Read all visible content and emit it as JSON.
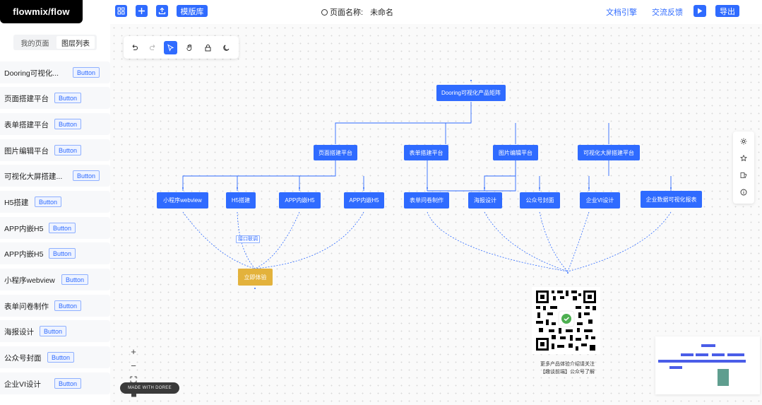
{
  "header": {
    "logo": "flowmix/flow",
    "template_label": "模版库",
    "page_name_label": "页面名称:",
    "page_name_value": "未命名",
    "doc_link": "文档引擎",
    "feedback_link": "交流反馈",
    "export_label": "导出"
  },
  "sidebar": {
    "tabs": [
      "我的页面",
      "图层列表"
    ],
    "active_tab": 1,
    "items": [
      {
        "label": "Dooring可视化...",
        "button": "Button"
      },
      {
        "label": "页面搭建平台",
        "button": "Button"
      },
      {
        "label": "表单搭建平台",
        "button": "Button"
      },
      {
        "label": "图片编辑平台",
        "button": "Button"
      },
      {
        "label": "可视化大屏搭建...",
        "button": "Button"
      },
      {
        "label": "H5搭建",
        "button": "Button"
      },
      {
        "label": "APP内嵌H5",
        "button": "Button"
      },
      {
        "label": "APP内嵌H5",
        "button": "Button"
      },
      {
        "label": "小程序webview",
        "button": "Button"
      },
      {
        "label": "表单问卷制作",
        "button": "Button"
      },
      {
        "label": "海报设计",
        "button": "Button"
      },
      {
        "label": "公众号封面",
        "button": "Button"
      },
      {
        "label": "企业VI设计",
        "button": "Button"
      }
    ]
  },
  "canvas": {
    "nodes": {
      "root": "Dooring可视化产品矩阵",
      "page": "页面搭建平台",
      "form": "表单搭建平台",
      "image": "图片编辑平台",
      "screen": "可视化大屏搭建平台",
      "miniapp": "小程序webview",
      "h5": "H5搭建",
      "app1": "APP内嵌H5",
      "app2": "APP内嵌H5",
      "survey": "表单问卷制作",
      "poster": "海报设计",
      "cover": "公众号封面",
      "vi": "企业VI设计",
      "report": "企业数据可视化报表",
      "start": "立即体验"
    },
    "edge_label": "接口联调",
    "qr_caption_line1": "更多产品体验介绍请关注",
    "qr_caption_line2": "【趣谈前端】公众号了解"
  },
  "badge": "MADE WITH DOREE",
  "colors": {
    "primary": "#2f6bff",
    "accent": "#e3b23c",
    "minimap_node": "#4a5de8",
    "minimap_block": "#5f9e8f"
  }
}
